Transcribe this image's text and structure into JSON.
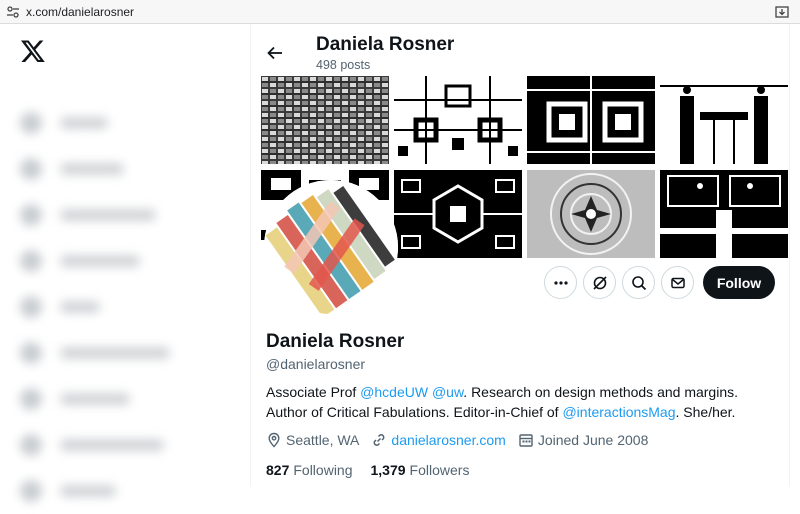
{
  "browser": {
    "url": "x.com/danielarosner"
  },
  "header": {
    "name": "Daniela Rosner",
    "posts": "498 posts"
  },
  "actions": {
    "follow_label": "Follow"
  },
  "profile": {
    "name": "Daniela Rosner",
    "handle": "@danielarosner",
    "bio": {
      "t1": "Associate Prof ",
      "m1": "@hcdeUW",
      "t2": " ",
      "m2": "@uw",
      "t3": ". Research on design methods and margins. Author of Critical Fabulations. Editor-in-Chief of ",
      "m3": "@interactionsMag",
      "t4": ". She/her."
    },
    "location": "Seattle, WA",
    "website": "danielarosner.com",
    "joined": "Joined June 2008",
    "following_count": "827",
    "following_label": "Following",
    "followers_count": "1,379",
    "followers_label": "Followers"
  },
  "colors": {
    "accent": "#1d9bf0",
    "text": "#0f1419",
    "secondary": "#536471",
    "follow_bg": "#0f1419"
  },
  "icons": [
    "x-logo-icon",
    "back-arrow-icon",
    "more-icon",
    "grok-icon",
    "search-icon",
    "mail-icon",
    "location-icon",
    "link-icon",
    "calendar-icon"
  ]
}
